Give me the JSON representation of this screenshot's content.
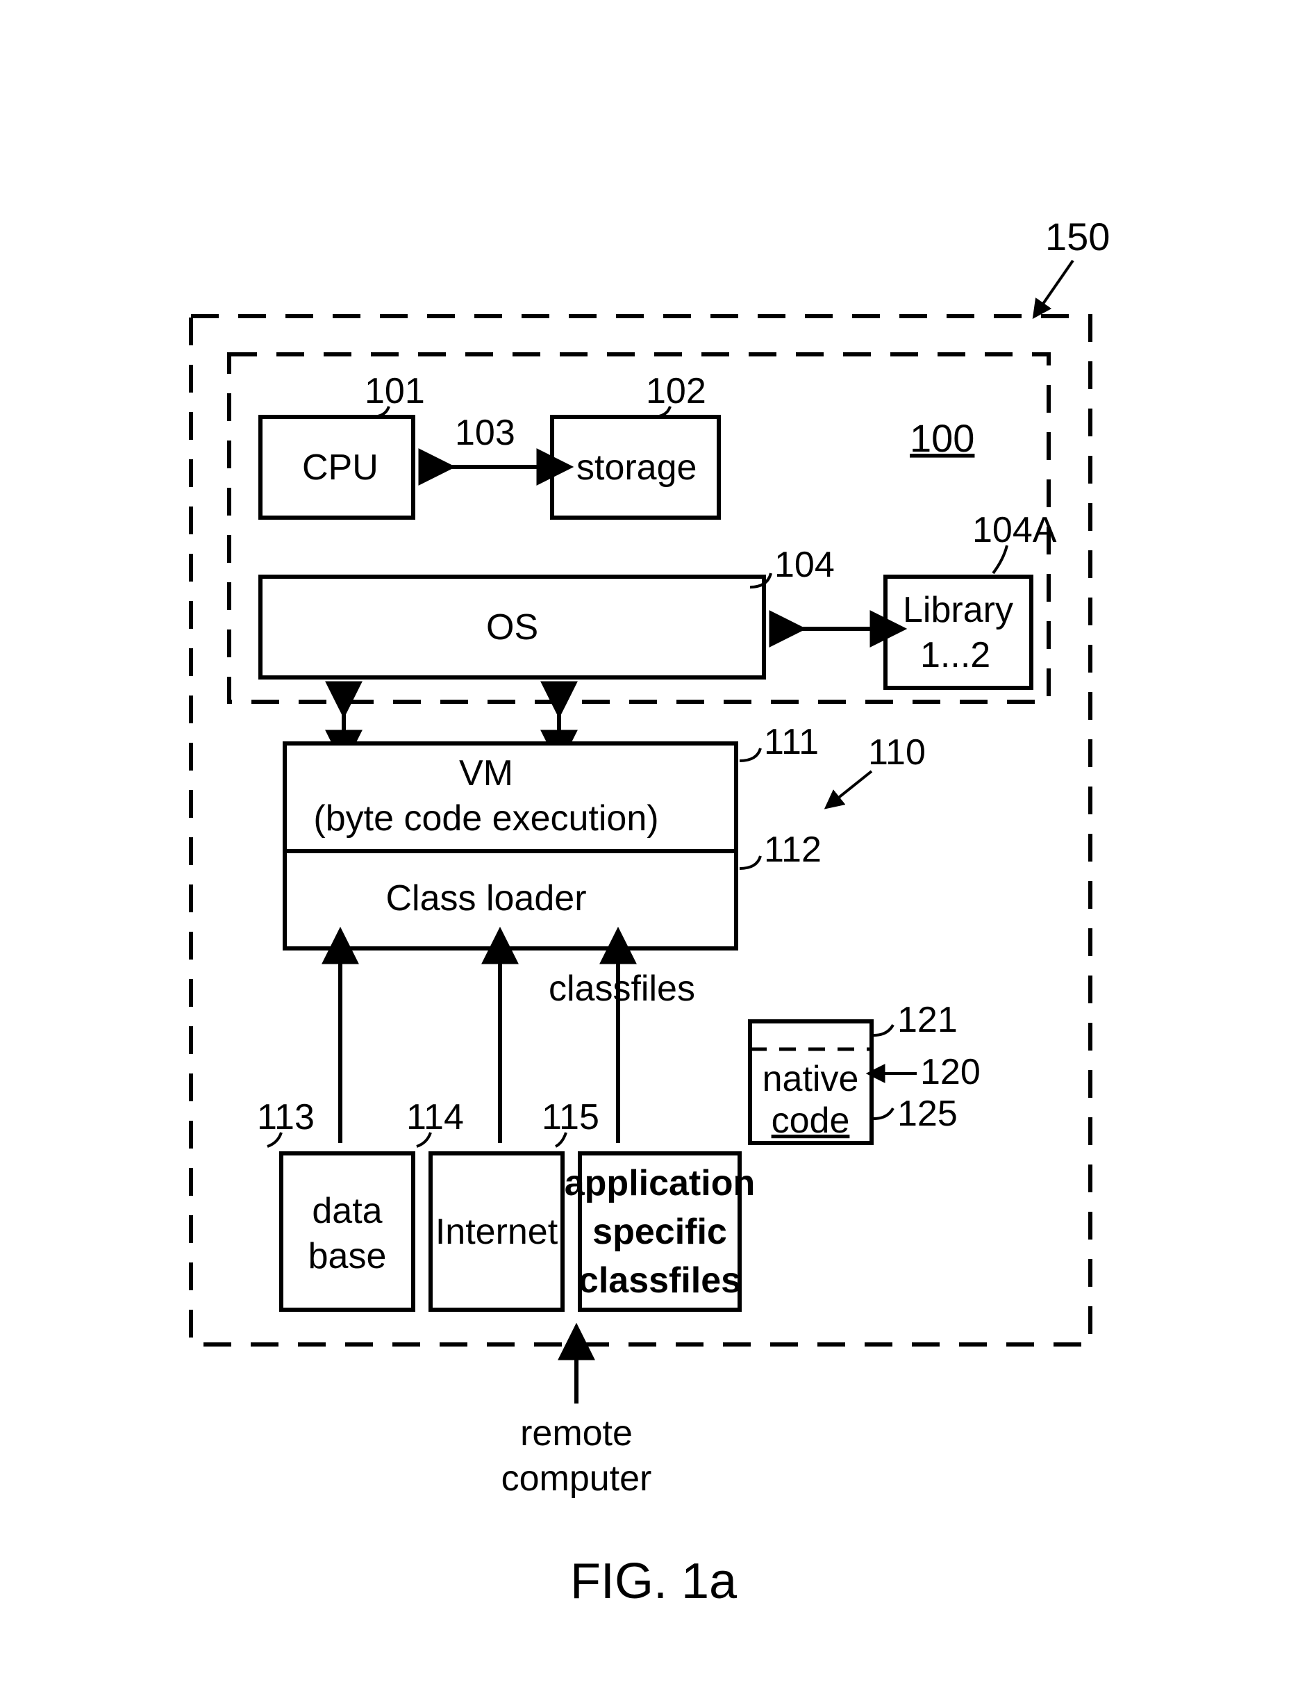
{
  "refs": {
    "r150": "150",
    "r100": "100",
    "r101": "101",
    "r102": "102",
    "r103": "103",
    "r104": "104",
    "r104A": "104A",
    "r110": "110",
    "r111": "111",
    "r112": "112",
    "r113": "113",
    "r114": "114",
    "r115": "115",
    "r120": "120",
    "r121": "121",
    "r125": "125"
  },
  "labels": {
    "cpu": "CPU",
    "storage": "storage",
    "os": "OS",
    "library1": "Library",
    "library2": "1...2",
    "vm1": "VM",
    "vm2": "(byte code execution)",
    "classloader": "Class loader",
    "classfiles": "classfiles",
    "native1": "native",
    "native2": "code",
    "database1": "data",
    "database2": "base",
    "internet": "Internet",
    "app1": "application",
    "app2": "specific",
    "app3": "classfiles",
    "remote1": "remote",
    "remote2": "computer",
    "fig": "FIG. 1a"
  }
}
